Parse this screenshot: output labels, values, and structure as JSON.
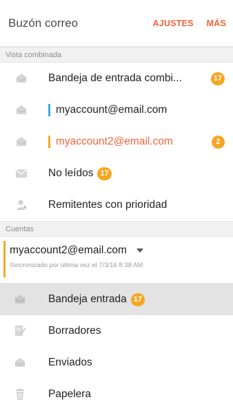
{
  "header": {
    "title": "Buzón correo",
    "settings_label": "AJUSTES",
    "more_label": "MÁS"
  },
  "combined_view": {
    "section_label": "Vista combinada",
    "items": [
      {
        "label": "Bandeja de entrada combi...",
        "badge": "17",
        "icon": "inbox-icon"
      },
      {
        "label": "myaccount@email.com",
        "icon": "inbox-icon",
        "bar_color": "#3fa5e8"
      },
      {
        "label": "myaccount2@email.com",
        "badge": "2",
        "icon": "inbox-icon",
        "bar_color": "#f6a623",
        "text_color": "#f0633a"
      },
      {
        "label": "No leídos",
        "badge": "17",
        "icon": "unread-mail-icon"
      },
      {
        "label": "Remitentes con prioridad",
        "icon": "priority-sender-icon"
      }
    ]
  },
  "accounts": {
    "section_label": "Cuentas",
    "current_account": {
      "email": "myaccount2@email.com",
      "sync_text": "Sincronizado por última vez el 7/3/16 8:38 AM"
    },
    "folders": [
      {
        "label": "Bandeja entrada",
        "badge": "17",
        "icon": "inbox-icon",
        "selected": true
      },
      {
        "label": "Borradores",
        "icon": "drafts-icon"
      },
      {
        "label": "Enviados",
        "icon": "sent-icon"
      },
      {
        "label": "Papelera",
        "icon": "trash-icon"
      }
    ]
  },
  "colors": {
    "accent": "#f0633a",
    "badge": "#f6a623",
    "account_blue": "#3fa5e8"
  }
}
